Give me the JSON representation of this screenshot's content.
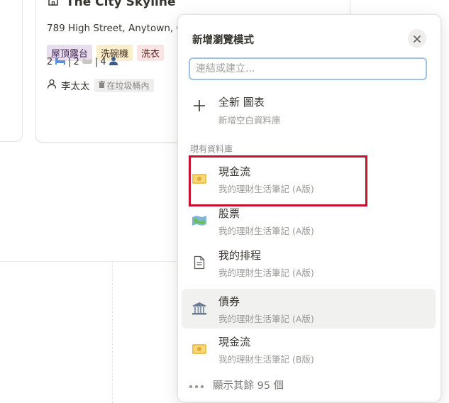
{
  "background_card": {
    "title": "The City Skyline",
    "address": "789 High Street, Anytown, C",
    "tags": [
      "屋頂露台",
      "洗碗機",
      "洗衣"
    ],
    "stats": {
      "bedrooms": "2",
      "bathrooms": "2",
      "guests": "4"
    },
    "owner": "李太太",
    "trash_badge": "在垃圾桶內"
  },
  "popup": {
    "title": "新增瀏覽模式",
    "search_placeholder": "連結或建立...",
    "new_item": {
      "label": "全新 圖表",
      "sublabel": "新增空白資料庫"
    },
    "section_label": "現有資料庫",
    "items": [
      {
        "label": "現金流",
        "sublabel": "我的理財生活筆記 (A版)",
        "icon": "money-icon"
      },
      {
        "label": "股票",
        "sublabel": "我的理財生活筆記 (A版)",
        "icon": "map-icon"
      },
      {
        "label": "我的排程",
        "sublabel": "我的理財生活筆記 (A版)",
        "icon": "document-icon"
      },
      {
        "label": "債券",
        "sublabel": "我的理財生活筆記 (A版)",
        "icon": "bank-icon"
      },
      {
        "label": "現金流",
        "sublabel": "我的理財生活筆記 (B版)",
        "icon": "money-icon"
      }
    ],
    "show_more": "顯示其餘 95 個"
  },
  "colors": {
    "highlight": "#c8102e",
    "input_focus": "#9ec3e8",
    "hover_bg": "#f1f1ef"
  }
}
